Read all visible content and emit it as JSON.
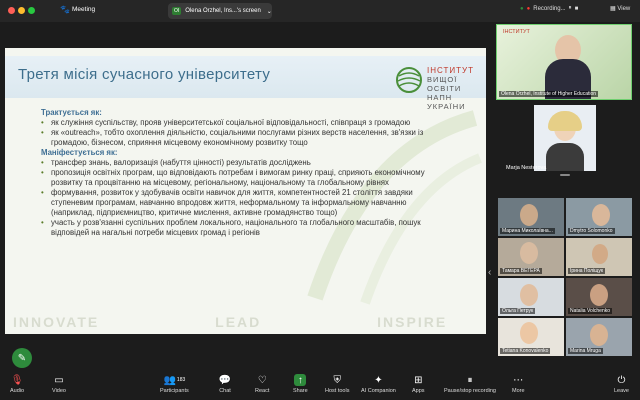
{
  "window": {
    "title": "Meeting"
  },
  "share_pill": {
    "label": "Olena Orzhel, Ins...'s screen",
    "badge": "OI"
  },
  "recording": {
    "label": "Recording..."
  },
  "view_label": "View",
  "slide": {
    "title": "Третя місія сучасного університету",
    "logo_line1": "ІНСТИТУТ",
    "logo_line2": "ВИЩОЇ ОСВІТИ",
    "logo_line3": "НАПН УКРАЇНИ",
    "heading1": "Трактується як:",
    "items1": [
      "як служіння суспільству, прояв університетської соціальної відповідальності, співпраця з громадою",
      "як «outreach», тобто охоплення діяльністю, соціальними послугами різних верств населення, зв'язки із громадою, бізнесом, сприяння місцевому економічному розвитку тощо"
    ],
    "heading2": "Маніфестується як:",
    "items2": [
      "трансфер знань, валоризація (набуття цінності) результатів досліджень",
      "пропозиція освітніх програм, що відповідають потребам і вимогам ринку праці, сприяють економічному розвитку та процвітанню на місцевому, регіональному, національному та глобальному рівнях",
      "формування, розвиток у здобувачів освіти навичок для життя, компетентностей 21 століття завдяки ступеневим програмам, навчанню впродовж життя, неформальному та інформальному навчанню (наприклад, підприємництво, критичне мислення, активне громадянство тощо)",
      "участь у розв'язанні суспільних проблем локального, національного та глобального масштабів, пошук відповідей на нагальні потреби місцевих громад і регіонів"
    ],
    "footer": [
      "INNOVATE",
      "LEAD",
      "INSPIRE"
    ]
  },
  "speakers": [
    {
      "name": "Olena Orzhel, Institute of Higher Education"
    },
    {
      "name": "Marja Nesterova"
    }
  ],
  "gallery": [
    {
      "name": "Марина Миколаївна..."
    },
    {
      "name": "Dmytro Solomonko"
    },
    {
      "name": "Тамара ВЕГЕРА"
    },
    {
      "name": "Ірина Поліщук"
    },
    {
      "name": "Ольга Петрук"
    },
    {
      "name": "Natalia Volchenko"
    },
    {
      "name": "Tetiana Konovalenko"
    },
    {
      "name": "Marina Mruga"
    }
  ],
  "toolbar": {
    "audio": "Audio",
    "video": "Video",
    "participants": "Participants",
    "participants_count": "183",
    "chat": "Chat",
    "react": "React",
    "share": "Share",
    "host_tools": "Host tools",
    "ai_companion": "AI Companion",
    "apps": "Apps",
    "pause_recording": "Pause/stop recording",
    "more": "More",
    "leave": "Leave"
  }
}
